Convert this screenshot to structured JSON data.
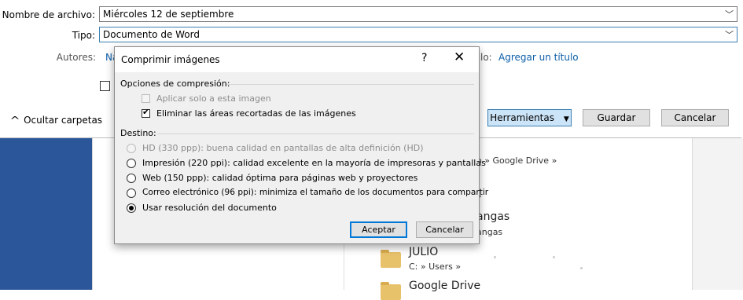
{
  "save_dialog": {
    "filename_label": "Nombre de archivo:",
    "filename_value": "Miércoles 12 de septiembre",
    "type_label": "Tipo:",
    "type_value": "Documento de Word",
    "authors_label": "Autores:",
    "authors_link_partial": "Na",
    "title_label_partial": "lo:",
    "title_link": "Agregar un título",
    "hide_folders_label": "Ocultar carpetas",
    "tools_button": "Herramientas",
    "save_button": "Guardar",
    "cancel_button": "Cancelar"
  },
  "file_list": {
    "items": [
      {
        "title": "",
        "sub": "o » Google Drive »"
      },
      {
        "title": "",
        "sub": "»"
      },
      {
        "title": "angas",
        "sub": "angas"
      },
      {
        "title": "JULIO",
        "sub": "C: » Users »"
      },
      {
        "title": "Google Drive",
        "sub": ""
      }
    ]
  },
  "compress_dialog": {
    "title": "Comprimir imágenes",
    "help": "?",
    "close": "✕",
    "compression_group": "Opciones de compresión:",
    "apply_only": "Aplicar solo a esta imagen",
    "apply_only_checked": false,
    "apply_only_enabled": false,
    "delete_cropped": "Eliminar las áreas recortadas de las imágenes",
    "delete_cropped_checked": true,
    "target_group": "Destino:",
    "options": [
      {
        "label": "HD (330 ppp): buena calidad en pantallas de alta definición (HD)",
        "enabled": false,
        "selected": false
      },
      {
        "label": "Impresión (220 ppi): calidad excelente en la mayoría de impresoras y pantallas",
        "enabled": true,
        "selected": false
      },
      {
        "label": "Web (150 ppp): calidad óptima para páginas web y proyectores",
        "enabled": true,
        "selected": false
      },
      {
        "label": "Correo electrónico (96 ppi): minimiza el tamaño de los documentos para compartir",
        "enabled": true,
        "selected": false
      },
      {
        "label": "Usar resolución del documento",
        "enabled": true,
        "selected": true
      }
    ],
    "accept_button": "Aceptar",
    "cancel_button": "Cancelar"
  },
  "colors": {
    "word_blue": "#2b579a",
    "link_blue": "#0b5ea8",
    "tools_button_bg": "#cce4f7"
  }
}
